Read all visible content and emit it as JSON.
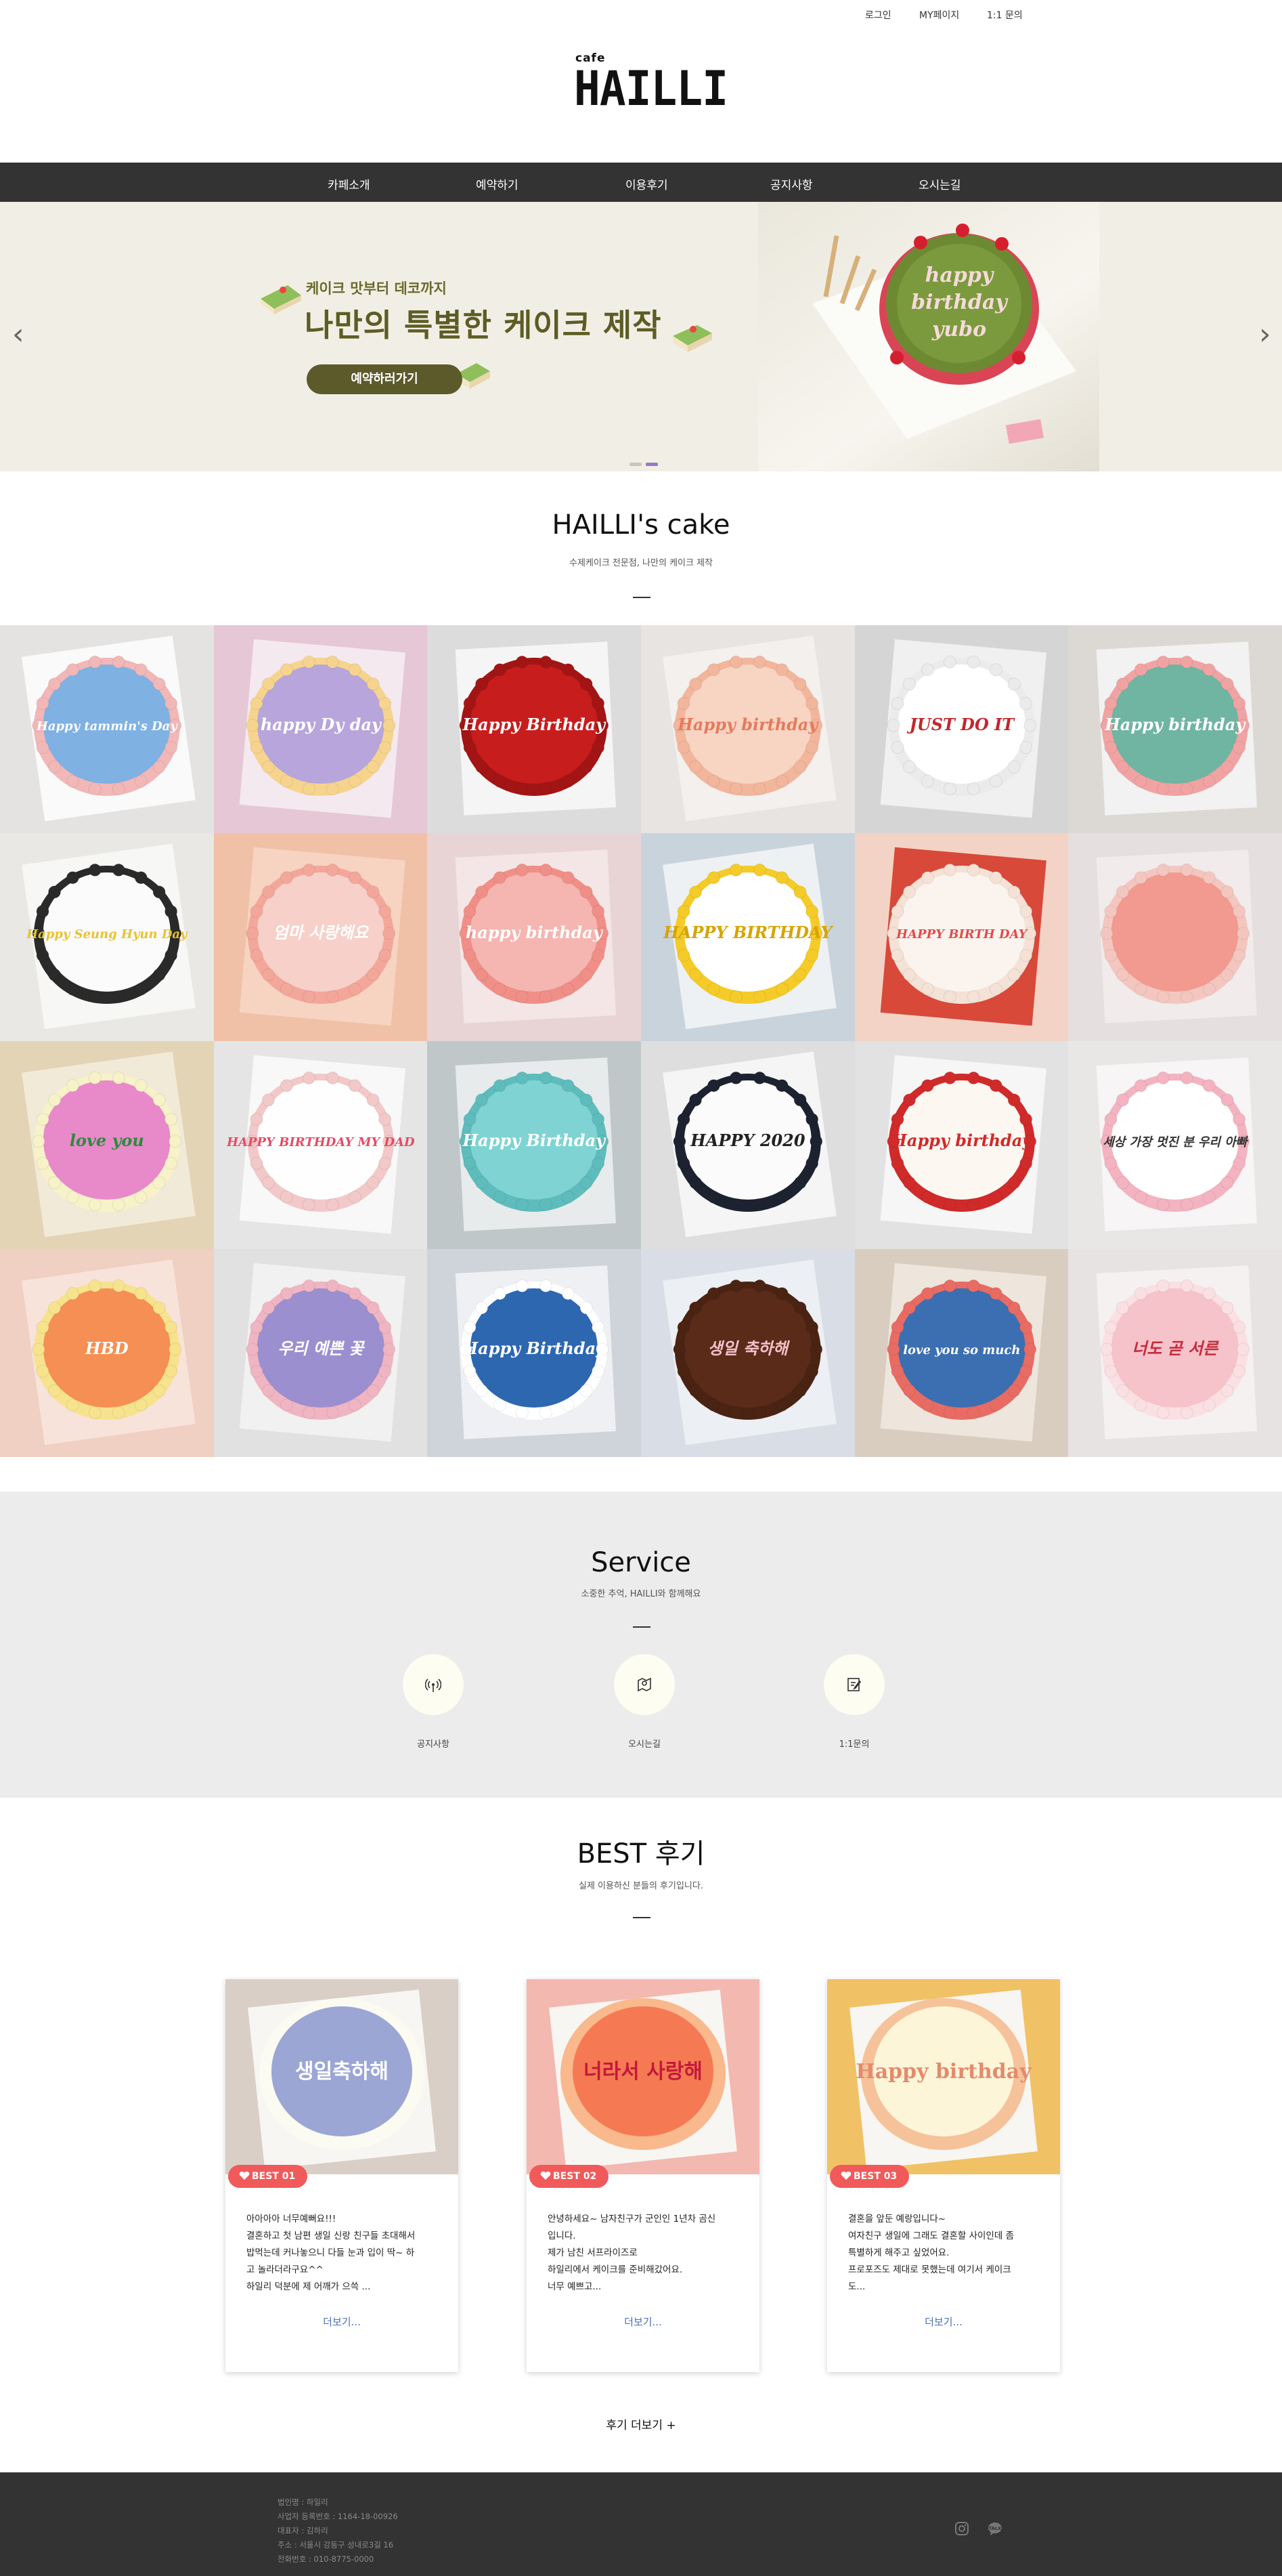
{
  "topbar": {
    "login": "로그인",
    "mypage": "MY페이지",
    "inquiry": "1:1 문의"
  },
  "logo": {
    "small": "cafe",
    "big": "HAILLI"
  },
  "nav": [
    "카페소개",
    "예약하기",
    "이용후기",
    "공지사항",
    "오시는길"
  ],
  "banner": {
    "subtitle": "케이크 맛부터 데코까지",
    "title": "나만의 특별한 케이크 제작",
    "cta": "예약하러가기",
    "cake_text": [
      "happy",
      "birthday",
      "yubo"
    ],
    "prev_arrow": "‹",
    "next_arrow": "›"
  },
  "gallery_section": {
    "title": "HAILLI's cake",
    "subtitle": "수제케이크 전문점, 나만의 케이크 제작"
  },
  "gallery": [
    {
      "bg": "#e4e3e1",
      "board": "#fafafa",
      "cake": "#7fb1e3",
      "rim": "#f2b7b7",
      "text": "Happy tammin's Day",
      "tc": "#ffffff"
    },
    {
      "bg": "#e6c7d6",
      "board": "#f4e9ef",
      "cake": "#b7a5dc",
      "rim": "#f6d48e",
      "text": "happy Dy day",
      "tc": "#ffffff"
    },
    {
      "bg": "#dcdcdc",
      "board": "#f5f5f5",
      "cake": "#c81d1d",
      "rim": "#a31515",
      "text": "Happy Birthday",
      "tc": "#ffffff"
    },
    {
      "bg": "#e8e4e2",
      "board": "#f3f0ee",
      "cake": "#f8d4c3",
      "rim": "#f2b69c",
      "text": "Happy birthday",
      "tc": "#e57a5c"
    },
    {
      "bg": "#d5d5d5",
      "board": "#f0f0f0",
      "cake": "#ffffff",
      "rim": "#ebebeb",
      "text": "JUST DO IT",
      "tc": "#c1272d"
    },
    {
      "bg": "#dcd9d5",
      "board": "#f2f2f2",
      "cake": "#6fb5a2",
      "rim": "#f1a3a3",
      "text": "Happy birthday",
      "tc": "#ffffff"
    },
    {
      "bg": "#e9e8e4",
      "board": "#f7f7f5",
      "cake": "#fbfbfb",
      "rim": "#2a2a2a",
      "text": "Happy Seung Hyun Day",
      "tc": "#e9c22e"
    },
    {
      "bg": "#f0c1a6",
      "board": "#f6d4c1",
      "cake": "#f6d0c9",
      "rim": "#f3a79a",
      "text": "엄마 사랑해요",
      "tc": "#ffffff"
    },
    {
      "bg": "#e8d4d4",
      "board": "#f4e6e6",
      "cake": "#f5b5b0",
      "rim": "#f08f88",
      "text": "happy birthday",
      "tc": "#ffffff"
    },
    {
      "bg": "#c9d3dc",
      "board": "#eef1f4",
      "cake": "#ffffff",
      "rim": "#f4cb28",
      "text": "HAPPY BIRTHDAY",
      "tc": "#d6a400"
    },
    {
      "bg": "#f3d3c5",
      "board": "#d8493a",
      "cake": "#fbf4ee",
      "rim": "#f3e2d5",
      "text": "HAPPY BIRTH DAY",
      "tc": "#e24b4b"
    },
    {
      "bg": "#e6dfdf",
      "board": "#f1ebeb",
      "cake": "#f29a8f",
      "rim": "#f3c7c0",
      "text": "",
      "tc": "#ffffff"
    },
    {
      "bg": "#e3d4b5",
      "board": "#f2ead8",
      "cake": "#e889c9",
      "rim": "#f7f2c8",
      "text": "love you",
      "tc": "#2e8a3d"
    },
    {
      "bg": "#e5e5e5",
      "board": "#f8f8f8",
      "cake": "#fefefe",
      "rim": "#f2c8c8",
      "text": "HAPPY BIRTHDAY MY DAD",
      "tc": "#e24d65"
    },
    {
      "bg": "#bfc7c9",
      "board": "#e7ebec",
      "cake": "#7fd3d3",
      "rim": "#5fbcbc",
      "text": "Happy Birthday",
      "tc": "#ffffff"
    },
    {
      "bg": "#dedede",
      "board": "#f5f5f5",
      "cake": "#fbfbfb",
      "rim": "#1d2230",
      "text": "HAPPY 2020",
      "tc": "#222222"
    },
    {
      "bg": "#e2e2e2",
      "board": "#f6f6f6",
      "cake": "#fdf7f1",
      "rim": "#d02a2a",
      "text": "Happy birthday",
      "tc": "#d02a2a"
    },
    {
      "bg": "#e9e6e6",
      "board": "#f7f5f5",
      "cake": "#ffffff",
      "rim": "#f3b3c0",
      "text": "세상 가장 멋진 분 우리 아빠",
      "tc": "#333333"
    },
    {
      "bg": "#efd0c2",
      "board": "#f7e3da",
      "cake": "#f58f53",
      "rim": "#f7e38d",
      "text": "HBD",
      "tc": "#ffffff"
    },
    {
      "bg": "#e1e1e1",
      "board": "#f1f1f1",
      "cake": "#9b8fcf",
      "rim": "#f0b5c2",
      "text": "우리 예쁜 꽃",
      "tc": "#ffffff"
    },
    {
      "bg": "#cfd4da",
      "board": "#eef0f3",
      "cake": "#2d67b0",
      "rim": "#ffffff",
      "text": "Happy Birthday",
      "tc": "#ffffff"
    },
    {
      "bg": "#d9dde5",
      "board": "#eceff4",
      "cake": "#5b2b19",
      "rim": "#4a2313",
      "text": "생일 축하해",
      "tc": "#f3c0c8"
    },
    {
      "bg": "#d8cdbf",
      "board": "#eee6dc",
      "cake": "#3c6fb1",
      "rim": "#e86c64",
      "text": "love you so much",
      "tc": "#ffffff"
    },
    {
      "bg": "#e7e3e3",
      "board": "#f5f1f1",
      "cake": "#f6c3cb",
      "rim": "#fbe0e3",
      "text": "너도 곧 서른",
      "tc": "#c42c3a"
    }
  ],
  "service": {
    "title": "Service",
    "subtitle": "소중한 추억, HAILLI와 함께해요",
    "items": [
      {
        "label": "공지사항",
        "icon": "broadcast-icon"
      },
      {
        "label": "오시는길",
        "icon": "map-pin-icon"
      },
      {
        "label": "1:1문의",
        "icon": "edit-icon"
      }
    ]
  },
  "reviews_section": {
    "title": "BEST 후기",
    "subtitle": "실제 이용하신 분들의 후기입니다."
  },
  "reviews": [
    {
      "badge": "BEST 01",
      "body": [
        "아아아아 너무예뻐요!!!",
        "결혼하고 첫 남편 생일 신랑 친구들 초대해서",
        "밥먹는데 커나놓으니 다들 눈과 입이 딱~ 하",
        "고 놀라더라구요^^",
        "하일리 덕분에 제 어깨가 으쓱 ..."
      ],
      "more": "더보기...",
      "cake": "#9ba6d4",
      "rim": "#fbfbf1",
      "bg": "#d9cfc7",
      "text": "생일축하해",
      "tc": "#ffffff"
    },
    {
      "badge": "BEST 02",
      "body": [
        "안녕하세요~ 남자친구가 군인인 1년차 곰신",
        "입니다.",
        "제가 남친 서프라이즈로",
        "하일리에서 케이크를 준비해갔어요.",
        "너무 예쁘고..."
      ],
      "more": "더보기...",
      "cake": "#f57a54",
      "rim": "#f9b98c",
      "bg": "#f3b8b0",
      "text": "너라서 사랑해",
      "tc": "#c4193a"
    },
    {
      "badge": "BEST 03",
      "body": [
        "결혼을 앞둔 예랑입니다~",
        "여자친구 생일에 그래도 결혼할 사이인데 좀",
        "특별하게 해주고 싶었어요.",
        "프로포즈도 제대로 못했는데 여기서 케이크",
        "도..."
      ],
      "more": "더보기...",
      "cake": "#fdf5d8",
      "rim": "#f6c29a",
      "bg": "#f0c265",
      "text": "Happy birthday",
      "tc": "#e38b6d"
    }
  ],
  "more_reviews": "후기 더보기 +",
  "footer": {
    "lines": [
      "법인명 : 하일리",
      "사업자 등록번호 : 1164-18-00926",
      "대표자 : 김하리",
      "주소 : 서울시 강동구 성내로3길 16",
      "전화번호 : 010-8775-0000"
    ],
    "icons": [
      "instagram-icon",
      "kakaotalk-icon"
    ]
  }
}
